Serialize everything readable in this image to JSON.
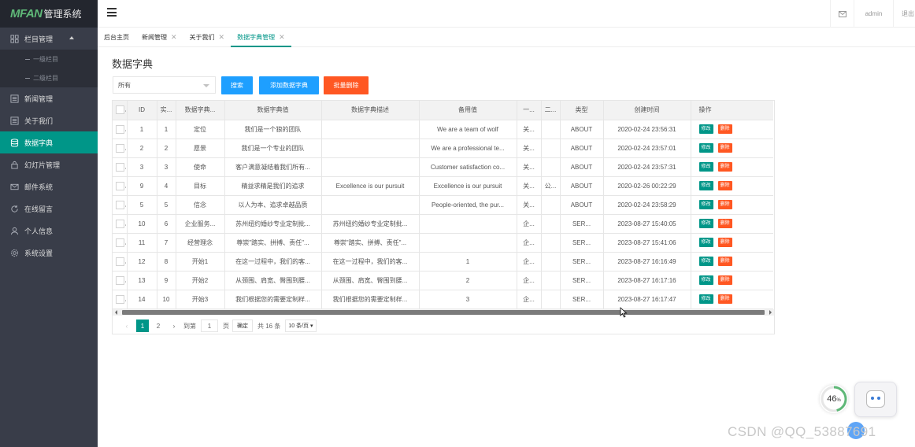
{
  "app": {
    "brand": "MFAN",
    "brand_sub": "管理系统"
  },
  "sidebar": {
    "items": [
      {
        "label": "栏目管理",
        "icon": "grid-icon"
      },
      {
        "label": "新闻管理",
        "icon": "list-icon"
      },
      {
        "label": "关于我们",
        "icon": "list-icon"
      },
      {
        "label": "数据字典",
        "icon": "database-icon",
        "active": true
      },
      {
        "label": "幻灯片管理",
        "icon": "lock-icon"
      },
      {
        "label": "邮件系统",
        "icon": "mail-icon"
      },
      {
        "label": "在线留言",
        "icon": "refresh-icon"
      },
      {
        "label": "个人信息",
        "icon": "user-icon"
      },
      {
        "label": "系统设置",
        "icon": "settings-icon"
      }
    ],
    "sub_items": [
      {
        "label": "一级栏目"
      },
      {
        "label": "二级栏目"
      }
    ]
  },
  "header": {
    "user": "admin",
    "logout": "退出"
  },
  "tabs": [
    {
      "label": "后台主页",
      "closable": false
    },
    {
      "label": "新闻管理",
      "closable": true
    },
    {
      "label": "关于我们",
      "closable": true
    },
    {
      "label": "数据字典管理",
      "closable": true,
      "active": true
    }
  ],
  "page": {
    "title": "数据字典"
  },
  "toolbar": {
    "filter_value": "所有",
    "search_label": "搜索",
    "add_label": "添加数据字典",
    "batch_delete_label": "批量删除"
  },
  "table": {
    "columns": [
      "ID",
      "实...",
      "数据字典...",
      "数据字典值",
      "数据字典描述",
      "备用值",
      "一...",
      "二...",
      "类型",
      "创建时间",
      "操作"
    ],
    "edit_label": "修改",
    "delete_label": "删除",
    "rows": [
      [
        "1",
        "1",
        "定位",
        "我们是一个狼的团队",
        "",
        "We are a team of wolf",
        "关...",
        "",
        "ABOUT",
        "2020-02-24 23:56:31"
      ],
      [
        "2",
        "2",
        "愿景",
        "我们是一个专业的团队",
        "",
        "We are a professional te...",
        "关...",
        "",
        "ABOUT",
        "2020-02-24 23:57:01"
      ],
      [
        "3",
        "3",
        "使命",
        "客户满意凝结着我们所有...",
        "",
        "Customer satisfaction co...",
        "关...",
        "",
        "ABOUT",
        "2020-02-24 23:57:31"
      ],
      [
        "9",
        "4",
        "目标",
        "精益求精是我们的追求",
        "Excellence is our pursuit",
        "Excellence is our pursuit",
        "关...",
        "公...",
        "ABOUT",
        "2020-02-26 00:22:29"
      ],
      [
        "5",
        "5",
        "信念",
        "以人为本、追求卓越品质",
        "",
        "People-oriented, the pur...",
        "关...",
        "",
        "ABOUT",
        "2020-02-24 23:58:29"
      ],
      [
        "10",
        "6",
        "企业服务...",
        "苏州纽约婚纱专业定制批...",
        "苏州纽约婚纱专业定制批...",
        "",
        "企...",
        "",
        "SER...",
        "2023-08-27 15:40:05"
      ],
      [
        "11",
        "7",
        "经营理念",
        "尊崇\"踏实、拼搏、责任\"...",
        "尊崇\"踏实、拼搏、责任\"...",
        "",
        "企...",
        "",
        "SER...",
        "2023-08-27 15:41:06"
      ],
      [
        "12",
        "8",
        "开始1",
        "在这一过程中，我们的客...",
        "在这一过程中，我们的客...",
        "1",
        "企...",
        "",
        "SER...",
        "2023-08-27 16:16:49"
      ],
      [
        "13",
        "9",
        "开始2",
        "从颈围、肩宽、臀围到腰...",
        "从颈围、肩宽、臀围到腰...",
        "2",
        "企...",
        "",
        "SER...",
        "2023-08-27 16:17:16"
      ],
      [
        "14",
        "10",
        "开始3",
        "我们根据您的需要定制样...",
        "我们根据您的需要定制样...",
        "3",
        "企...",
        "",
        "SER...",
        "2023-08-27 16:17:47"
      ]
    ]
  },
  "pagination": {
    "current": "1",
    "next_page": "2",
    "goto_label": "到第",
    "goto_value": "1",
    "page_unit": "页",
    "confirm_label": "确定",
    "total_label": "共 16 条",
    "page_size_label": "10 条/页"
  },
  "widgets": {
    "progress_value": "46",
    "progress_unit": "%",
    "progress_fraction": 0.46
  },
  "watermark": "CSDN @QQ_53887691",
  "colors": {
    "sidebar_bg": "#393D49",
    "accent": "#009688",
    "blue": "#1E9FFF",
    "orange": "#FF5722"
  }
}
